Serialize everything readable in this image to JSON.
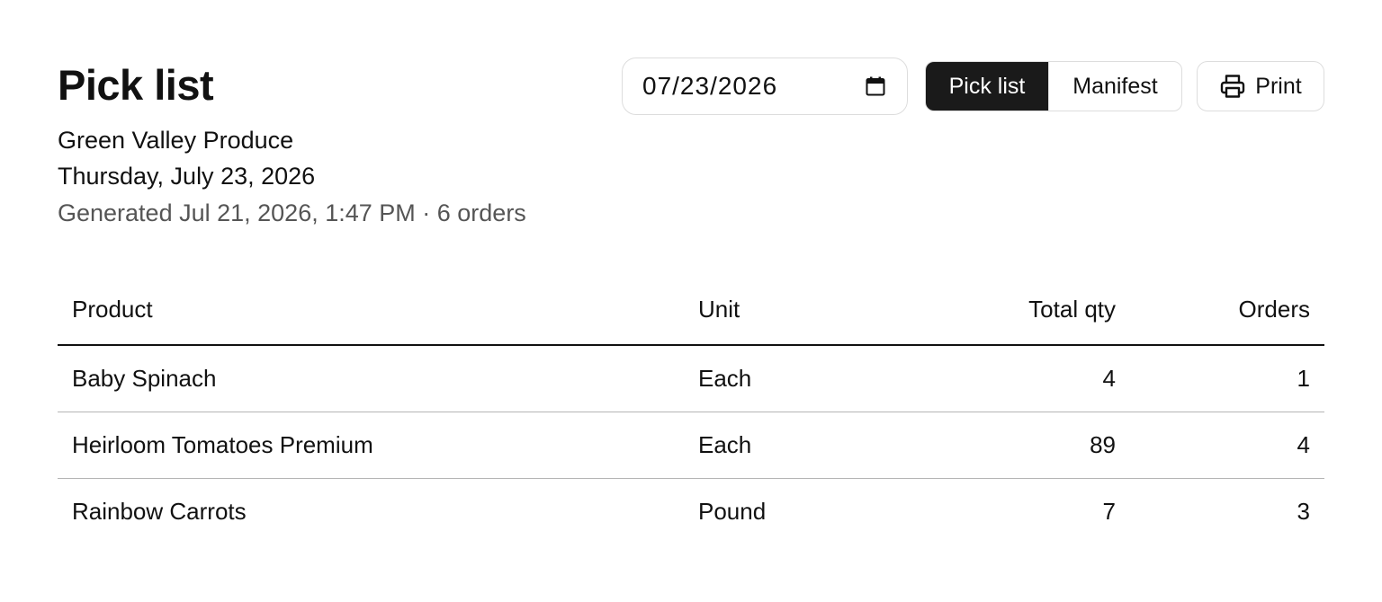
{
  "header": {
    "title": "Pick list",
    "supplier": "Green Valley Produce",
    "date_label": "Thursday, July 23, 2026",
    "generated": "Generated Jul 21, 2026, 1:47 PM · 6 orders"
  },
  "toolbar": {
    "date_value": "07/23/2026",
    "calendar_icon": "calendar-icon",
    "view_toggle": {
      "pick_list_label": "Pick list",
      "manifest_label": "Manifest",
      "selected": "Pick list"
    },
    "print_label": "Print",
    "print_icon": "printer-icon"
  },
  "table": {
    "columns": [
      "Product",
      "Unit",
      "Total qty",
      "Orders"
    ],
    "rows": [
      {
        "product": "Baby Spinach",
        "unit": "Each",
        "total_qty": "4",
        "orders": "1"
      },
      {
        "product": "Heirloom Tomatoes Premium",
        "unit": "Each",
        "total_qty": "89",
        "orders": "4"
      },
      {
        "product": "Rainbow Carrots",
        "unit": "Pound",
        "total_qty": "7",
        "orders": "3"
      }
    ]
  },
  "colors": {
    "text": "#111111",
    "muted": "#555555",
    "active_toggle": "#1a1a1a",
    "border": "#dddddd",
    "row_divider": "#b5b5b5"
  }
}
